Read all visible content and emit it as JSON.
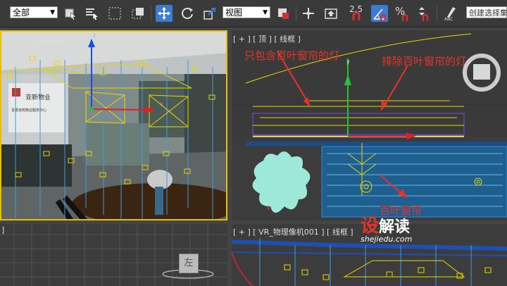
{
  "toolbar": {
    "selection_filter": "全部",
    "reference_coord": "视图",
    "snap_value": "2.5",
    "named_selection_placeholder": "创建选择集"
  },
  "viewports": {
    "top_left": {
      "label": "机001 [ 明暗处理 ]"
    },
    "top_right": {
      "label": "[ + ] [ 顶 ] [ 线框 ]"
    },
    "bottom_left": {
      "label": "]",
      "viewcube_face": "左"
    },
    "bottom_right": {
      "label": "[ + ] [ VR_物理像机001 ] [ 线框 ]"
    }
  },
  "scene": {
    "logo_company": "亚新物业",
    "logo_sub": "青泽佳苑物业服务中心"
  },
  "annotations": {
    "include_light": "只包含百叶窗帘的灯",
    "exclude_light": "排除百叶窗帘的灯",
    "blinds": "百叶窗帘"
  },
  "watermark": {
    "brand_prefix": "设",
    "brand_suffix": "解读",
    "url": "shejiedu.com"
  },
  "colors": {
    "annotation": "#e8332a",
    "active_tool": "#3b7bd0",
    "viewport_active_border": "#e8c200",
    "light_gizmo": "#e8d700",
    "wire_blue": "#2f8fd8",
    "blinds_fill": "#1f5f8f",
    "plant": "#9de8d8"
  }
}
